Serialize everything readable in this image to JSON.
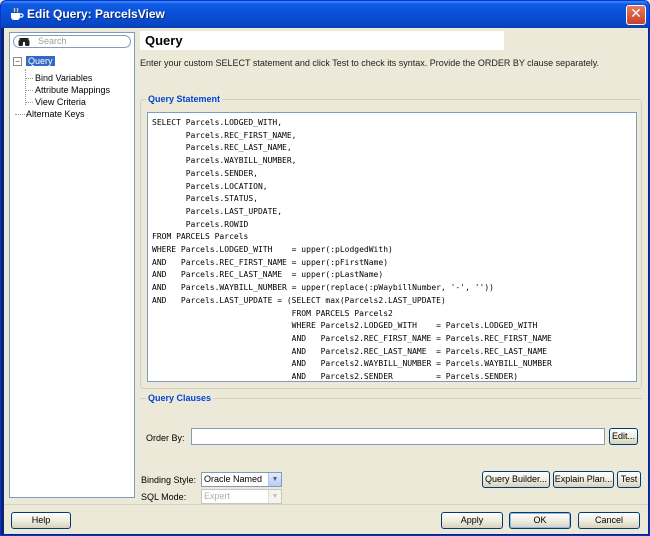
{
  "window": {
    "title": "Edit Query: ParcelsView",
    "close_glyph": "✕"
  },
  "nav": {
    "search_placeholder": "Search",
    "expander_glyph": "−",
    "items": [
      {
        "label": "Query"
      },
      {
        "label": "Bind Variables"
      },
      {
        "label": "Attribute Mappings"
      },
      {
        "label": "View Criteria"
      },
      {
        "label": "Alternate Keys"
      }
    ]
  },
  "page": {
    "title": "Query",
    "instructions": "Enter your custom SELECT statement and click Test to check its syntax.  Provide the ORDER BY clause separately."
  },
  "query_statement": {
    "label": "Query Statement",
    "sql": "SELECT Parcels.LODGED_WITH,\n       Parcels.REC_FIRST_NAME,\n       Parcels.REC_LAST_NAME,\n       Parcels.WAYBILL_NUMBER,\n       Parcels.SENDER,\n       Parcels.LOCATION,\n       Parcels.STATUS,\n       Parcels.LAST_UPDATE,\n       Parcels.ROWID\nFROM PARCELS Parcels\nWHERE Parcels.LODGED_WITH    = upper(:pLodgedWith)\nAND   Parcels.REC_FIRST_NAME = upper(:pFirstName)\nAND   Parcels.REC_LAST_NAME  = upper(:pLastName)\nAND   Parcels.WAYBILL_NUMBER = upper(replace(:pWaybillNumber, '-', ''))\nAND   Parcels.LAST_UPDATE = (SELECT max(Parcels2.LAST_UPDATE)\n                             FROM PARCELS Parcels2\n                             WHERE Parcels2.LODGED_WITH    = Parcels.LODGED_WITH\n                             AND   Parcels2.REC_FIRST_NAME = Parcels.REC_FIRST_NAME\n                             AND   Parcels2.REC_LAST_NAME  = Parcels.REC_LAST_NAME\n                             AND   Parcels2.WAYBILL_NUMBER = Parcels.WAYBILL_NUMBER\n                             AND   Parcels2.SENDER         = Parcels.SENDER)"
  },
  "query_clauses": {
    "label": "Query Clauses",
    "order_by_label": "Order By:",
    "order_by_value": "",
    "edit_button": "Edit..."
  },
  "options": {
    "binding_style_label": "Binding Style:",
    "binding_style_value": "Oracle Named",
    "sql_mode_label": "SQL Mode:",
    "sql_mode_value": "Expert",
    "dropdown_glyph": "▼"
  },
  "actions": {
    "query_builder": "Query Builder...",
    "explain_plan": "Explain Plan...",
    "test": "Test"
  },
  "footer": {
    "help": "Help",
    "apply": "Apply",
    "ok": "OK",
    "cancel": "Cancel"
  },
  "colors": {
    "titlebar": "#0a4fd6",
    "selection": "#316ac5",
    "group_label": "#0046d5",
    "dialog_bg": "#ece9d8"
  }
}
